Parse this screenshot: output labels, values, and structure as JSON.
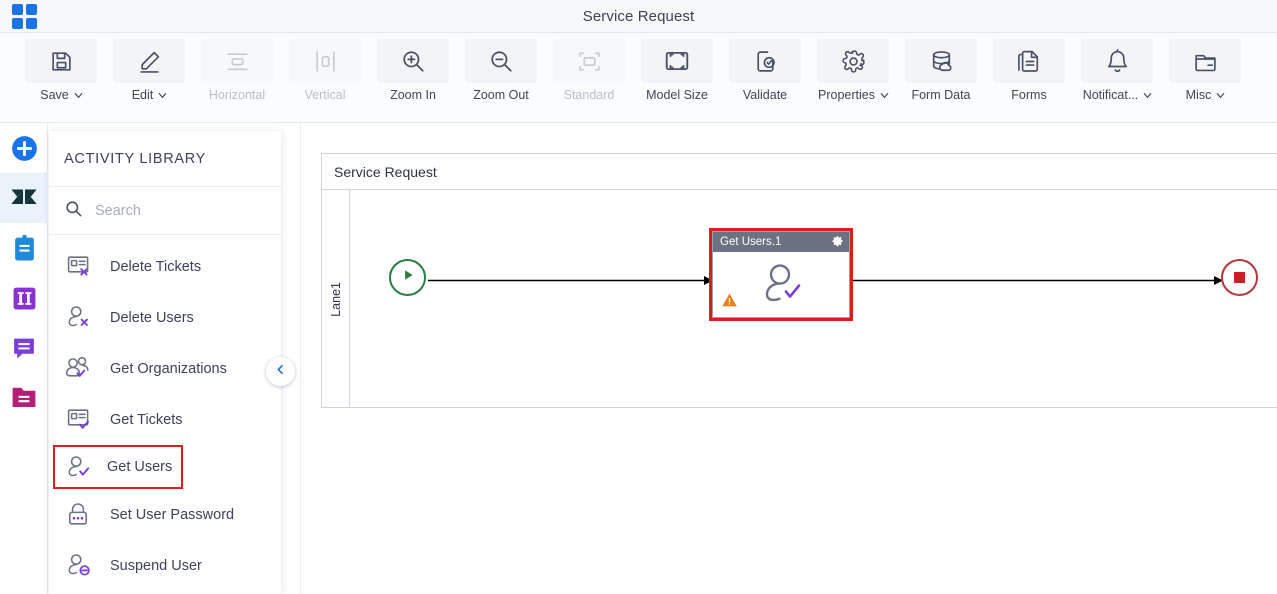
{
  "window": {
    "title": "Service Request",
    "app_launcher_icon": "grid-apps-icon",
    "accent_blue": "#1a73e8"
  },
  "ribbon": {
    "items": [
      {
        "label": "Save",
        "icon": "save-floppy-icon",
        "caret": true,
        "disabled": false
      },
      {
        "label": "Edit",
        "icon": "pencil-edit-icon",
        "caret": true,
        "disabled": false
      },
      {
        "label": "Horizontal",
        "icon": "horizontal-align-icon",
        "caret": false,
        "disabled": true
      },
      {
        "label": "Vertical",
        "icon": "vertical-align-icon",
        "caret": false,
        "disabled": true
      },
      {
        "label": "Zoom In",
        "icon": "zoom-in-icon",
        "caret": false,
        "disabled": false
      },
      {
        "label": "Zoom Out",
        "icon": "zoom-out-icon",
        "caret": false,
        "disabled": false
      },
      {
        "label": "Standard",
        "icon": "standard-size-icon",
        "caret": false,
        "disabled": true
      },
      {
        "label": "Model Size",
        "icon": "model-size-icon",
        "caret": false,
        "disabled": false
      },
      {
        "label": "Validate",
        "icon": "validate-check-icon",
        "caret": false,
        "disabled": false
      },
      {
        "label": "Properties",
        "icon": "gear-icon",
        "caret": true,
        "disabled": false
      },
      {
        "label": "Form Data",
        "icon": "database-cloud-icon",
        "caret": false,
        "disabled": false
      },
      {
        "label": "Forms",
        "icon": "document-forms-icon",
        "caret": false,
        "disabled": false
      },
      {
        "label": "Notificat...",
        "icon": "bell-icon",
        "caret": true,
        "disabled": false
      },
      {
        "label": "Misc",
        "icon": "folder-misc-icon",
        "caret": true,
        "disabled": false
      }
    ]
  },
  "rail": {
    "items": [
      {
        "name": "add-new",
        "icon": "plus-circle-icon",
        "color": "#1a73e8",
        "active": false
      },
      {
        "name": "zendesk",
        "icon": "zendesk-logo-icon",
        "color": "#16343c",
        "active": true
      },
      {
        "name": "tasks",
        "icon": "clipboard-icon",
        "color": "#1f88d9",
        "active": false
      },
      {
        "name": "columns",
        "icon": "columns-icon",
        "color": "#8833cc",
        "active": false
      },
      {
        "name": "messages",
        "icon": "chat-bubble-icon",
        "color": "#7b3fd4",
        "active": false
      },
      {
        "name": "documents",
        "icon": "folder-lines-icon",
        "color": "#b51f7a",
        "active": false
      }
    ]
  },
  "library": {
    "title": "ACTIVITY LIBRARY",
    "search": {
      "value": "",
      "placeholder": "Search",
      "icon": "search-icon"
    },
    "collapse_icon": "chevron-left-icon",
    "items": [
      {
        "label": "Delete Tickets",
        "icon": "card-delete-icon",
        "highlighted": false
      },
      {
        "label": "Delete Users",
        "icon": "user-delete-icon",
        "highlighted": false
      },
      {
        "label": "Get Organizations",
        "icon": "users-check-icon",
        "highlighted": false
      },
      {
        "label": "Get Tickets",
        "icon": "card-check-icon",
        "highlighted": false
      },
      {
        "label": "Get Users",
        "icon": "user-check-icon",
        "highlighted": true
      },
      {
        "label": "Set User Password",
        "icon": "lock-password-icon",
        "highlighted": false
      },
      {
        "label": "Suspend User",
        "icon": "user-suspend-icon",
        "highlighted": false
      }
    ],
    "highlight_color": "#e01b1b"
  },
  "canvas": {
    "pool_title": "Service Request",
    "lane_label": "Lane1",
    "start_node": {
      "icon": "start-event-play-icon",
      "color": "#2a7d42"
    },
    "end_node": {
      "icon": "end-event-stop-icon",
      "color": "#b3383a"
    },
    "task": {
      "title": "Get Users.1",
      "gear_icon": "gear-icon",
      "warning_icon": "warning-triangle-icon",
      "body_icon": "user-check-icon",
      "selected_color": "#e01b1b",
      "header_color": "#6b7383"
    },
    "flows": [
      {
        "name": "flow-start-to-task"
      },
      {
        "name": "flow-task-to-end"
      }
    ]
  }
}
